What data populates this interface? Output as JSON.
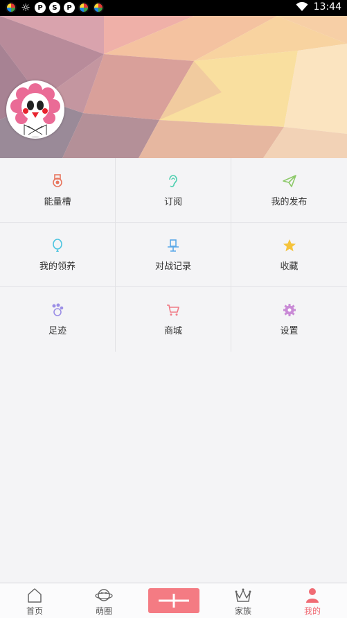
{
  "status_bar": {
    "time": "13:44",
    "notification_icons": [
      "multicolor-app-icon",
      "sun-icon",
      "p-icon",
      "s-icon",
      "p-icon",
      "multicolor-app-icon",
      "multicolor-app-icon"
    ]
  },
  "profile": {
    "avatar_icon": "flower-avatar"
  },
  "menu": {
    "rows": [
      [
        {
          "label": "能量槽",
          "icon": "medal-icon",
          "color": "#e8765f"
        },
        {
          "label": "订阅",
          "icon": "ear-icon",
          "color": "#4fcfb0"
        },
        {
          "label": "我的发布",
          "icon": "paper-plane-icon",
          "color": "#8dc96a"
        }
      ],
      [
        {
          "label": "我的领养",
          "icon": "balloon-icon",
          "color": "#4cc4e0"
        },
        {
          "label": "对战记录",
          "icon": "battle-icon",
          "color": "#5aa8e8"
        },
        {
          "label": "收藏",
          "icon": "star-icon",
          "color": "#f5c33b"
        }
      ],
      [
        {
          "label": "足迹",
          "icon": "paw-icon",
          "color": "#9b8ee6"
        },
        {
          "label": "商城",
          "icon": "cart-icon",
          "color": "#f07b86"
        },
        {
          "label": "设置",
          "icon": "gear-icon",
          "color": "#c98ad6"
        }
      ]
    ]
  },
  "bottom_nav": {
    "items": [
      {
        "label": "首页",
        "icon": "home-icon"
      },
      {
        "label": "萌圈",
        "icon": "planet-icon"
      },
      {
        "label": "",
        "icon": "plus-icon"
      },
      {
        "label": "家族",
        "icon": "crown-icon"
      },
      {
        "label": "我的",
        "icon": "person-icon",
        "active": true
      }
    ],
    "accent_color": "#f06b74"
  }
}
